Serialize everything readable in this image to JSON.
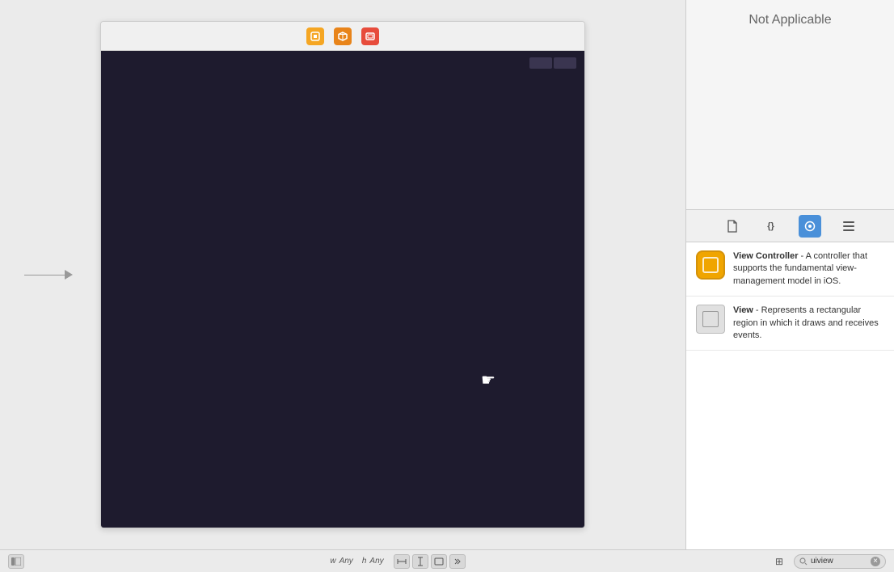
{
  "header": {
    "not_applicable": "Not Applicable"
  },
  "canvas": {
    "arrow_label": "scene arrow"
  },
  "toolbar": {
    "icons": [
      {
        "name": "component-icon",
        "color": "orange",
        "symbol": "⬡"
      },
      {
        "name": "box-icon",
        "color": "orange-red",
        "symbol": "❑"
      },
      {
        "name": "controller-icon",
        "color": "red",
        "symbol": "▣"
      }
    ]
  },
  "inspector": {
    "tabs": [
      {
        "id": "file-tab",
        "label": "File",
        "icon": "⎕",
        "active": false
      },
      {
        "id": "braces-tab",
        "label": "Code",
        "icon": "{}",
        "active": false
      },
      {
        "id": "circle-tab",
        "label": "Identity",
        "icon": "◎",
        "active": true
      },
      {
        "id": "list-tab",
        "label": "Attributes",
        "icon": "≡",
        "active": false
      }
    ],
    "items": [
      {
        "id": "view-controller-item",
        "title": "View Controller",
        "description": " - A controller that supports the fundamental view-management model in iOS."
      },
      {
        "id": "view-item",
        "title": "View",
        "description": " - Represents a rectangular region in which it draws and receives events."
      }
    ]
  },
  "bottom": {
    "w_size": "Any",
    "h_size": "Any",
    "w_label": "w",
    "h_label": "h",
    "search_placeholder": "uiview",
    "search_value": "uiview"
  }
}
